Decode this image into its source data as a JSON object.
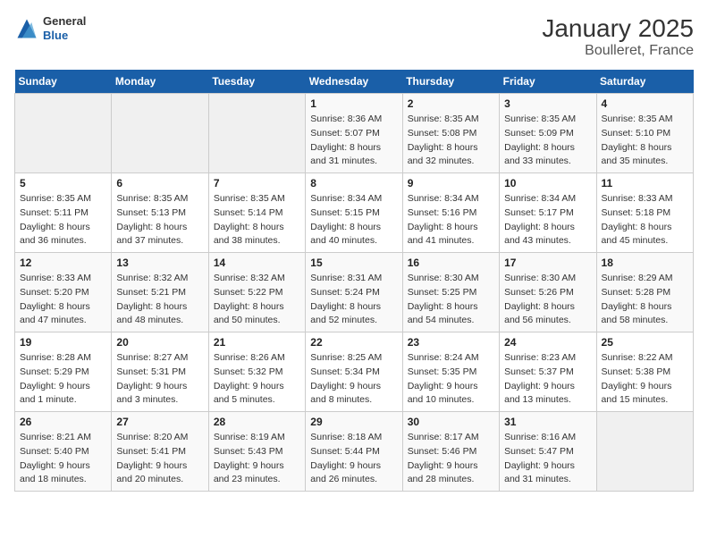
{
  "header": {
    "logo_general": "General",
    "logo_blue": "Blue",
    "title": "January 2025",
    "subtitle": "Boulleret, France"
  },
  "columns": [
    "Sunday",
    "Monday",
    "Tuesday",
    "Wednesday",
    "Thursday",
    "Friday",
    "Saturday"
  ],
  "weeks": [
    [
      {
        "num": "",
        "info": ""
      },
      {
        "num": "",
        "info": ""
      },
      {
        "num": "",
        "info": ""
      },
      {
        "num": "1",
        "info": "Sunrise: 8:36 AM\nSunset: 5:07 PM\nDaylight: 8 hours and 31 minutes."
      },
      {
        "num": "2",
        "info": "Sunrise: 8:35 AM\nSunset: 5:08 PM\nDaylight: 8 hours and 32 minutes."
      },
      {
        "num": "3",
        "info": "Sunrise: 8:35 AM\nSunset: 5:09 PM\nDaylight: 8 hours and 33 minutes."
      },
      {
        "num": "4",
        "info": "Sunrise: 8:35 AM\nSunset: 5:10 PM\nDaylight: 8 hours and 35 minutes."
      }
    ],
    [
      {
        "num": "5",
        "info": "Sunrise: 8:35 AM\nSunset: 5:11 PM\nDaylight: 8 hours and 36 minutes."
      },
      {
        "num": "6",
        "info": "Sunrise: 8:35 AM\nSunset: 5:13 PM\nDaylight: 8 hours and 37 minutes."
      },
      {
        "num": "7",
        "info": "Sunrise: 8:35 AM\nSunset: 5:14 PM\nDaylight: 8 hours and 38 minutes."
      },
      {
        "num": "8",
        "info": "Sunrise: 8:34 AM\nSunset: 5:15 PM\nDaylight: 8 hours and 40 minutes."
      },
      {
        "num": "9",
        "info": "Sunrise: 8:34 AM\nSunset: 5:16 PM\nDaylight: 8 hours and 41 minutes."
      },
      {
        "num": "10",
        "info": "Sunrise: 8:34 AM\nSunset: 5:17 PM\nDaylight: 8 hours and 43 minutes."
      },
      {
        "num": "11",
        "info": "Sunrise: 8:33 AM\nSunset: 5:18 PM\nDaylight: 8 hours and 45 minutes."
      }
    ],
    [
      {
        "num": "12",
        "info": "Sunrise: 8:33 AM\nSunset: 5:20 PM\nDaylight: 8 hours and 47 minutes."
      },
      {
        "num": "13",
        "info": "Sunrise: 8:32 AM\nSunset: 5:21 PM\nDaylight: 8 hours and 48 minutes."
      },
      {
        "num": "14",
        "info": "Sunrise: 8:32 AM\nSunset: 5:22 PM\nDaylight: 8 hours and 50 minutes."
      },
      {
        "num": "15",
        "info": "Sunrise: 8:31 AM\nSunset: 5:24 PM\nDaylight: 8 hours and 52 minutes."
      },
      {
        "num": "16",
        "info": "Sunrise: 8:30 AM\nSunset: 5:25 PM\nDaylight: 8 hours and 54 minutes."
      },
      {
        "num": "17",
        "info": "Sunrise: 8:30 AM\nSunset: 5:26 PM\nDaylight: 8 hours and 56 minutes."
      },
      {
        "num": "18",
        "info": "Sunrise: 8:29 AM\nSunset: 5:28 PM\nDaylight: 8 hours and 58 minutes."
      }
    ],
    [
      {
        "num": "19",
        "info": "Sunrise: 8:28 AM\nSunset: 5:29 PM\nDaylight: 9 hours and 1 minute."
      },
      {
        "num": "20",
        "info": "Sunrise: 8:27 AM\nSunset: 5:31 PM\nDaylight: 9 hours and 3 minutes."
      },
      {
        "num": "21",
        "info": "Sunrise: 8:26 AM\nSunset: 5:32 PM\nDaylight: 9 hours and 5 minutes."
      },
      {
        "num": "22",
        "info": "Sunrise: 8:25 AM\nSunset: 5:34 PM\nDaylight: 9 hours and 8 minutes."
      },
      {
        "num": "23",
        "info": "Sunrise: 8:24 AM\nSunset: 5:35 PM\nDaylight: 9 hours and 10 minutes."
      },
      {
        "num": "24",
        "info": "Sunrise: 8:23 AM\nSunset: 5:37 PM\nDaylight: 9 hours and 13 minutes."
      },
      {
        "num": "25",
        "info": "Sunrise: 8:22 AM\nSunset: 5:38 PM\nDaylight: 9 hours and 15 minutes."
      }
    ],
    [
      {
        "num": "26",
        "info": "Sunrise: 8:21 AM\nSunset: 5:40 PM\nDaylight: 9 hours and 18 minutes."
      },
      {
        "num": "27",
        "info": "Sunrise: 8:20 AM\nSunset: 5:41 PM\nDaylight: 9 hours and 20 minutes."
      },
      {
        "num": "28",
        "info": "Sunrise: 8:19 AM\nSunset: 5:43 PM\nDaylight: 9 hours and 23 minutes."
      },
      {
        "num": "29",
        "info": "Sunrise: 8:18 AM\nSunset: 5:44 PM\nDaylight: 9 hours and 26 minutes."
      },
      {
        "num": "30",
        "info": "Sunrise: 8:17 AM\nSunset: 5:46 PM\nDaylight: 9 hours and 28 minutes."
      },
      {
        "num": "31",
        "info": "Sunrise: 8:16 AM\nSunset: 5:47 PM\nDaylight: 9 hours and 31 minutes."
      },
      {
        "num": "",
        "info": ""
      }
    ]
  ]
}
